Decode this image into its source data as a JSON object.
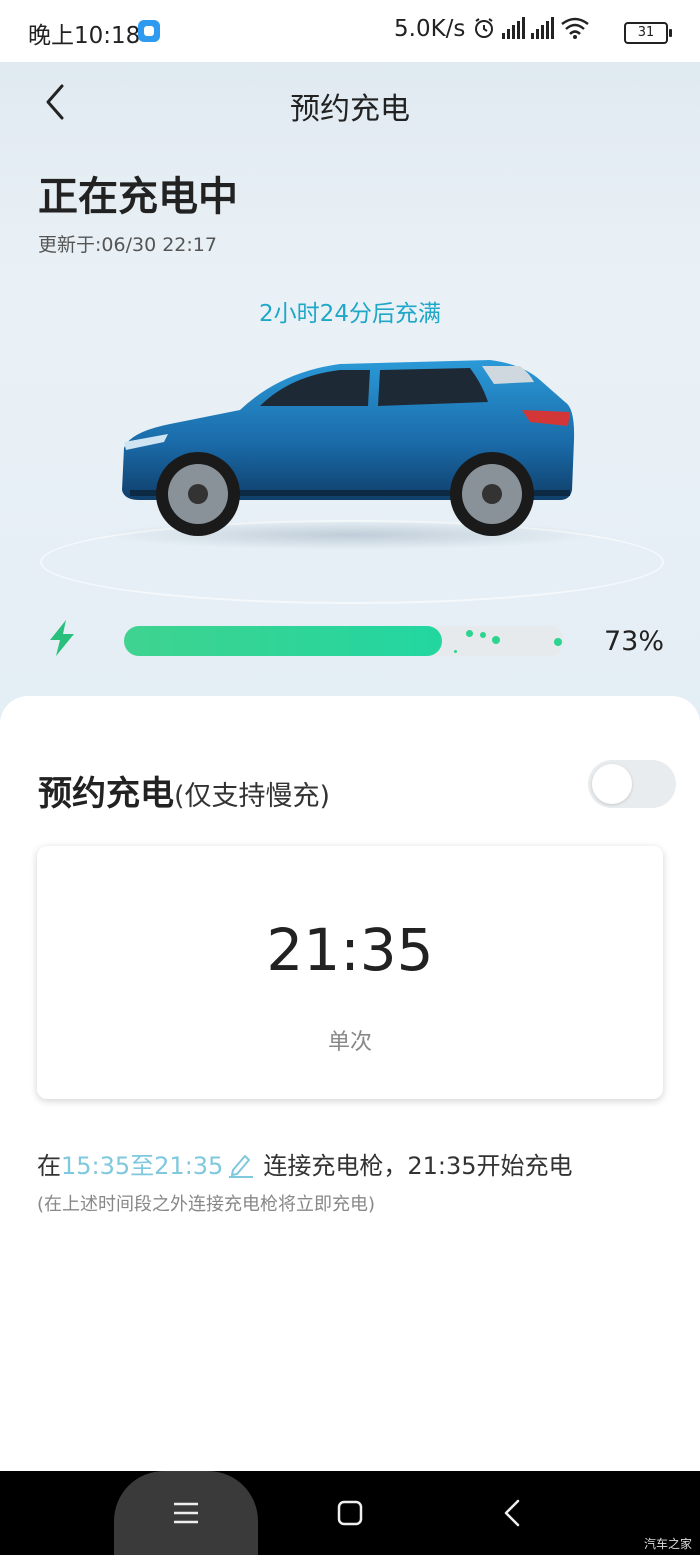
{
  "status_bar": {
    "time": "晚上10:18",
    "net_speed": "5.0K/s",
    "battery": "31"
  },
  "header": {
    "title": "预约充电"
  },
  "charging": {
    "state": "正在充电中",
    "updated": "更新于:06/30 22:17",
    "eta": "2小时24分后充满",
    "percent_label": "73%",
    "level": 0.73
  },
  "schedule": {
    "title": "预约充电",
    "subtitle": "(仅支持慢充)",
    "enabled": false,
    "time": "21:35",
    "mode": "单次",
    "info_prefix": "在",
    "info_range": "15:35至21:35",
    "info_suffix": "连接充电枪，21:35开始充电",
    "note": "(在上述时间段之外连接充电枪将立即充电)"
  },
  "watermark": "汽车之家",
  "colors": {
    "accent": "#1fa7c7",
    "progress": "#2bd48f",
    "car": "#1f7fc0"
  }
}
